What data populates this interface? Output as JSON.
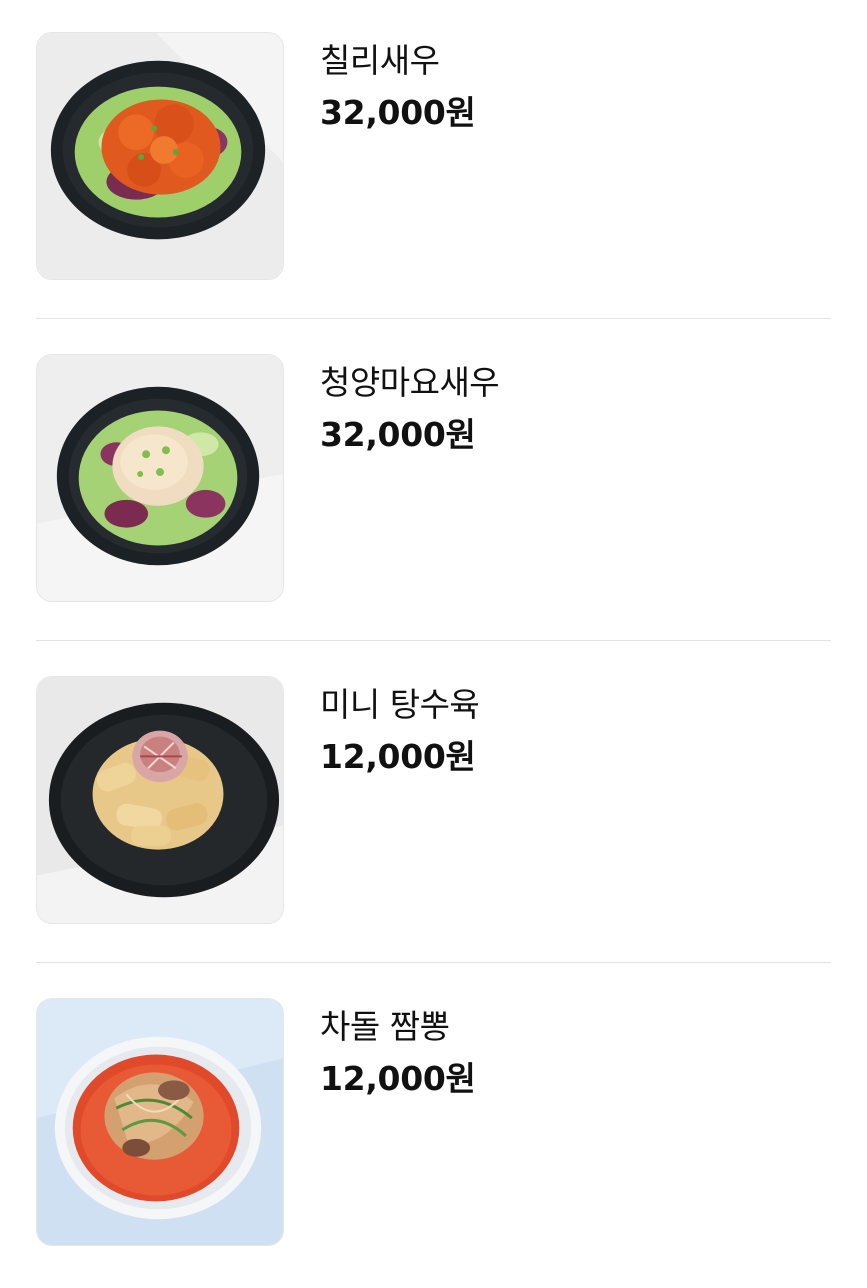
{
  "menu": {
    "items": [
      {
        "name": "칠리새우",
        "price": "32,000원",
        "image": "chili-shrimp-photo"
      },
      {
        "name": "청양마요새우",
        "price": "32,000원",
        "image": "cheongyang-mayo-shrimp-photo"
      },
      {
        "name": "미니 탕수육",
        "price": "12,000원",
        "image": "mini-tangsuyuk-photo"
      },
      {
        "name": "차돌 짬뽕",
        "price": "12,000원",
        "image": "chadol-jjamppong-photo"
      }
    ]
  },
  "colors": {
    "divider": "#e3e3e3",
    "text": "#111111",
    "background": "#ffffff"
  }
}
